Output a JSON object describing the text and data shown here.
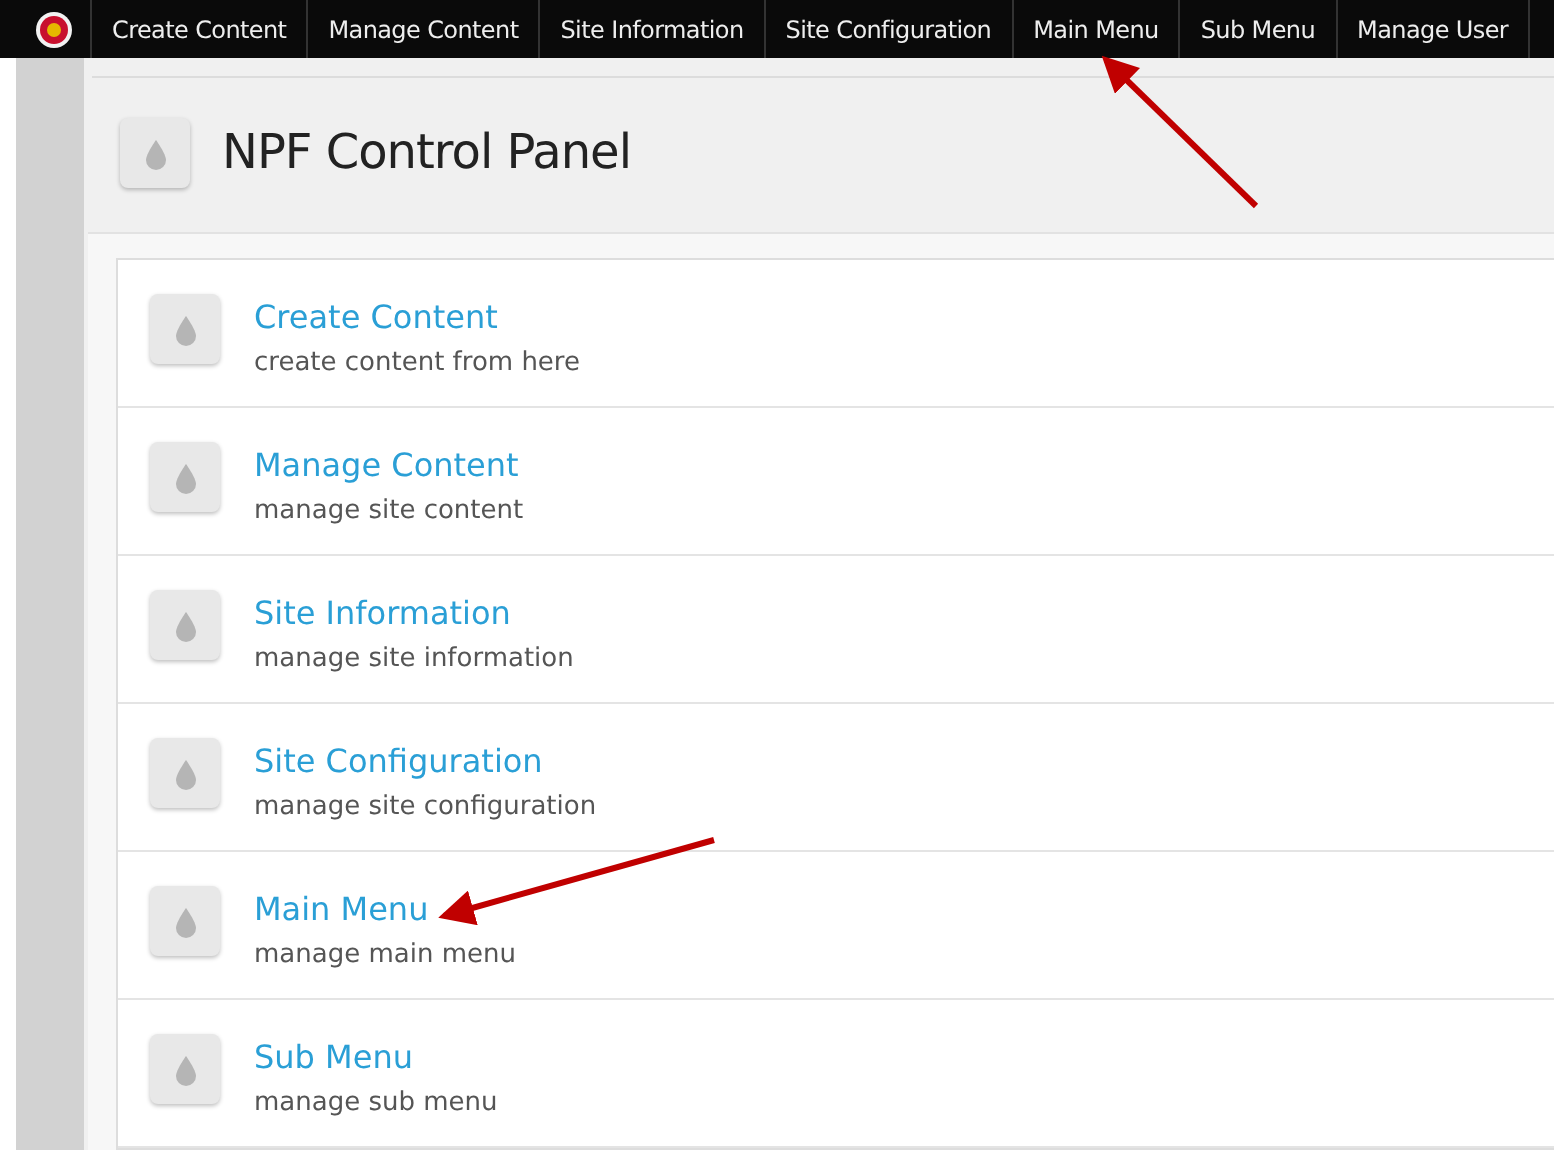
{
  "top_menu": [
    {
      "label": "Create Content"
    },
    {
      "label": "Manage Content"
    },
    {
      "label": "Site Information"
    },
    {
      "label": "Site Configuration"
    },
    {
      "label": "Main Menu"
    },
    {
      "label": "Sub Menu"
    },
    {
      "label": "Manage User"
    }
  ],
  "page_title": "NPF Control Panel",
  "items": [
    {
      "title": "Create Content",
      "description": "create content from here"
    },
    {
      "title": "Manage Content",
      "description": "manage site content"
    },
    {
      "title": "Site Information",
      "description": "manage site information"
    },
    {
      "title": "Site Configuration",
      "description": "manage site configuration"
    },
    {
      "title": "Main Menu",
      "description": "manage main menu"
    },
    {
      "title": "Sub Menu",
      "description": "manage sub menu"
    }
  ]
}
